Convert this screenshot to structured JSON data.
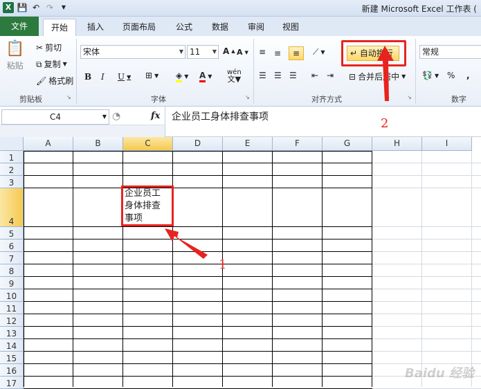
{
  "window": {
    "title": "新建 Microsoft Excel 工作表 ("
  },
  "tabs": [
    "文件",
    "开始",
    "插入",
    "页面布局",
    "公式",
    "数据",
    "审阅",
    "视图"
  ],
  "clipboard": {
    "paste": "粘贴",
    "cut": "剪切",
    "copy": "复制",
    "format_painter": "格式刷",
    "label": "剪贴板"
  },
  "font": {
    "name": "宋体",
    "size": "11",
    "label": "字体",
    "bold": "B",
    "italic": "I",
    "underline": "U",
    "inc": "A",
    "dec": "A",
    "phonetic": "wén"
  },
  "alignment": {
    "wrap_text": "自动换行",
    "merge_center": "合并后居中",
    "label": "对齐方式"
  },
  "number": {
    "format": "常规",
    "percent": "%",
    "comma": ",",
    "label": "数字"
  },
  "formula_bar": {
    "name_box": "C4",
    "fx": "fx",
    "content": "企业员工身体排查事项"
  },
  "grid": {
    "columns": [
      "A",
      "B",
      "C",
      "D",
      "E",
      "F",
      "G",
      "H",
      "I"
    ],
    "rows": [
      "1",
      "2",
      "3",
      "4",
      "5",
      "6",
      "7",
      "8",
      "9",
      "10",
      "11",
      "12",
      "13",
      "14",
      "15",
      "16",
      "17"
    ],
    "active_col": "C",
    "active_row": "4",
    "cell_c4_lines": [
      "企业员工",
      "身体排查",
      "事项"
    ]
  },
  "annotations": {
    "one": "1",
    "two": "2"
  },
  "watermark": "Baidu 经验",
  "colors": {
    "file_tab": "#2c7a3d",
    "highlight": "#e8231e",
    "active_header": "#f5c94f"
  }
}
